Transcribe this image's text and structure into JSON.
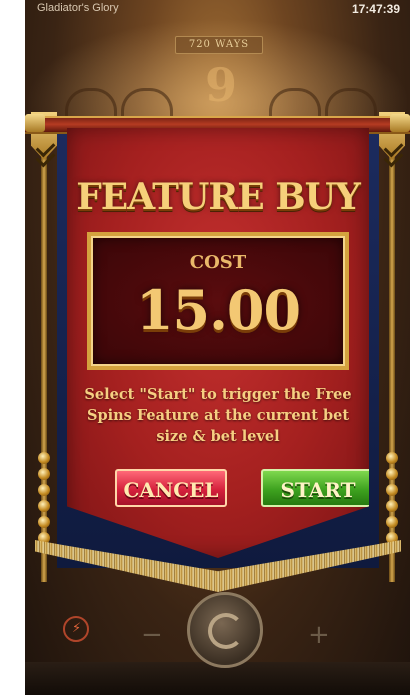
{
  "status_bar": {
    "app_title": "Gladiator's Glory",
    "time": "17:47:39"
  },
  "background": {
    "ways_label": "720 WAYS",
    "multiplier": "9"
  },
  "dialog": {
    "title": "FEATURE BUY",
    "cost_label": "COST",
    "cost_value": "15.00",
    "description": "Select \"Start\" to trigger the Free Spins Feature at the current bet size & bet level",
    "cancel_label": "CANCEL",
    "start_label": "START"
  },
  "colors": {
    "banner_red": "#a4201f",
    "gold_text": "#f6d07a",
    "cancel_pink": "#d5213c",
    "start_green": "#3ea21f"
  },
  "icons": [
    "turbo-icon",
    "minus-icon",
    "spin-icon",
    "plus-icon"
  ]
}
